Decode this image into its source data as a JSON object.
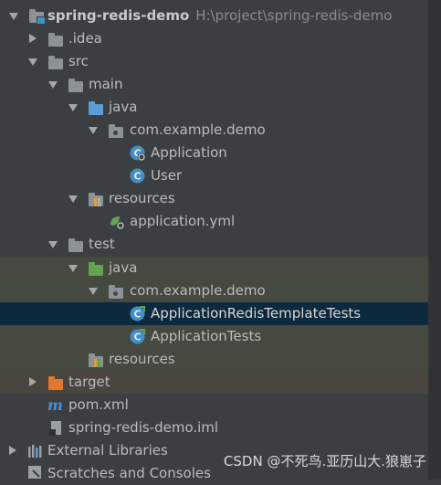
{
  "project": {
    "name": "spring-redis-demo",
    "path": "H:\\project\\spring-redis-demo"
  },
  "tree": {
    "idea": ".idea",
    "src": "src",
    "main": "main",
    "main_java": "java",
    "main_package": "com.example.demo",
    "application_class": "Application",
    "user_class": "User",
    "main_resources": "resources",
    "application_yml": "application.yml",
    "test": "test",
    "test_java": "java",
    "test_package": "com.example.demo",
    "redis_tests": "ApplicationRedisTemplateTests",
    "app_tests": "ApplicationTests",
    "test_resources": "resources",
    "target": "target",
    "pom": "pom.xml",
    "iml": "spring-redis-demo.iml",
    "external_libraries": "External Libraries",
    "scratches": "Scratches and Consoles"
  },
  "watermark": "CSDN @不死鸟.亚历山大.狼崽子",
  "colors": {
    "background": "#3c3f41",
    "selected_row": "#0d293e",
    "test_highlight": "#45493f",
    "excluded_highlight": "#4a453f",
    "folder_gray": "#8c9297",
    "folder_blue": "#5c9fd6",
    "folder_green": "#62a352",
    "folder_orange": "#e0782f",
    "class_icon": "#3f8fcb"
  }
}
